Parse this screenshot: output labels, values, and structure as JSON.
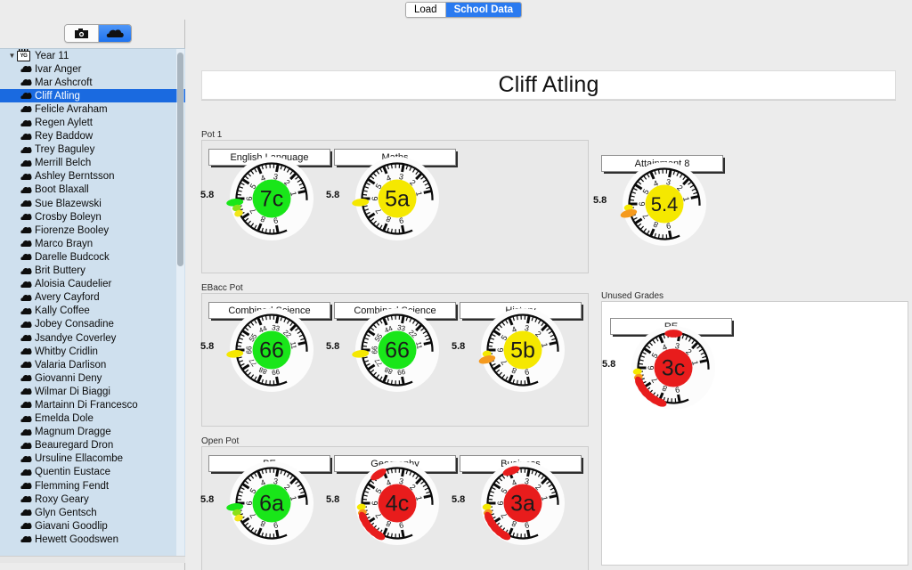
{
  "window": {
    "load_label": "Load",
    "school_data_label": "School Data"
  },
  "sidebar": {
    "view_icons": [
      "dial-view-icon",
      "line-chart-view-icon",
      "table-view-icon"
    ],
    "selected_view": 0,
    "toolbar_icons": [
      "camera-icon",
      "cloud-icon"
    ],
    "selected_toolbar": 1,
    "group": {
      "label": "Year 11",
      "icon": "year-group-icon"
    },
    "selected_student": "Cliff Atling",
    "students": [
      "Ivar Anger",
      "Mar Ashcroft",
      "Cliff Atling",
      "Felicle Avraham",
      "Regen Aylett",
      "Rey Baddow",
      "Trey Baguley",
      "Merrill Belch",
      "Ashley Berntsson",
      "Boot Blaxall",
      "Sue Blazewski",
      "Crosby Boleyn",
      "Fiorenze Booley",
      "Marco Brayn",
      "Darelle Budcock",
      "Brit Buttery",
      "Aloisia Caudelier",
      "Avery Cayford",
      "Kally Coffee",
      "Jobey Consadine",
      "Jsandye Coverley",
      "Whitby Cridlin",
      "Valaria Darlison",
      "Giovanni Deny",
      "Wilmar Di Biaggi",
      "Martainn Di Francesco",
      "Emelda Dole",
      "Magnum Dragge",
      "Beauregard Dron",
      "Ursuline Ellacombe",
      "Quentin Eustace",
      "Flemming Fendt",
      "Roxy Geary",
      "Glyn Gentsch",
      "Giavani Goodlip",
      "Hewett Goodswen"
    ]
  },
  "main": {
    "student_title": "Cliff Atling",
    "sections": {
      "pot1": "Pot 1",
      "ebacc": "EBacc Pot",
      "open": "Open Pot",
      "unused": "Unused Grades"
    }
  },
  "chart_data": {
    "type": "gauge",
    "scale_min": 1,
    "scale_max": 9,
    "target_label": "5.8",
    "gauges": [
      {
        "id": "english-language",
        "section": "pot1",
        "subject": "English Language",
        "grade": "7c",
        "grade_color": "#19e619",
        "value": 7.3,
        "target": 5.8,
        "dial_labels": [
          "1",
          "2",
          "3",
          "4",
          "5",
          "6",
          "7",
          "8",
          "9"
        ],
        "markers": [
          {
            "color": "#19e619",
            "size": "large",
            "offset": 0
          },
          {
            "color": "#8be01a",
            "size": "small",
            "offset": 1
          },
          {
            "color": "#f2e61a",
            "size": "small",
            "offset": 2
          }
        ],
        "trail": []
      },
      {
        "id": "maths",
        "section": "pot1",
        "subject": "Maths",
        "grade": "5a",
        "grade_color": "#f5e800",
        "value": 5.9,
        "target": 5.8,
        "dial_labels": [
          "1",
          "2",
          "3",
          "4",
          "5",
          "6",
          "7",
          "8",
          "9"
        ],
        "markers": [
          {
            "color": "#f5e800",
            "size": "large",
            "offset": 0
          }
        ],
        "trail": []
      },
      {
        "id": "attainment-8",
        "section": "attainment",
        "subject": "Attainment 8",
        "grade": "5.4",
        "grade_color": "#f5e800",
        "value": 5.4,
        "target": 5.8,
        "dial_labels": [
          "1",
          "2",
          "3",
          "4",
          "5",
          "6",
          "7",
          "8",
          "9"
        ],
        "markers": [
          {
            "color": "#f5e800",
            "size": "small",
            "offset": 0
          },
          {
            "color": "#f59a1e",
            "size": "large",
            "offset": 1
          }
        ],
        "trail": []
      },
      {
        "id": "combined-science-1",
        "section": "ebacc",
        "subject": "Combined Science",
        "grade": "66",
        "grade_color": "#19e619",
        "value": 6.0,
        "target": 5.8,
        "dial_labels": [
          "11",
          "22",
          "33",
          "44",
          "55",
          "66",
          "77",
          "88",
          "99"
        ],
        "markers": [
          {
            "color": "#f5e800",
            "size": "large",
            "offset": 0
          }
        ],
        "trail": []
      },
      {
        "id": "combined-science-2",
        "section": "ebacc",
        "subject": "Combined Science",
        "grade": "66",
        "grade_color": "#19e619",
        "value": 6.0,
        "target": 5.8,
        "dial_labels": [
          "11",
          "22",
          "33",
          "44",
          "55",
          "66",
          "77",
          "88",
          "99"
        ],
        "markers": [
          {
            "color": "#f5e800",
            "size": "large",
            "offset": 0
          }
        ],
        "trail": []
      },
      {
        "id": "history",
        "section": "ebacc",
        "subject": "History",
        "grade": "5b",
        "grade_color": "#f5e800",
        "value": 5.5,
        "target": 5.8,
        "dial_labels": [
          "1",
          "2",
          "3",
          "4",
          "5",
          "6",
          "7",
          "8",
          "9"
        ],
        "markers": [
          {
            "color": "#f5e800",
            "size": "small",
            "offset": 0
          },
          {
            "color": "#f59a1e",
            "size": "large",
            "offset": 1
          }
        ],
        "trail": []
      },
      {
        "id": "pe",
        "section": "open",
        "subject": "PE",
        "grade": "6a",
        "grade_color": "#19e619",
        "value": 6.9,
        "target": 5.8,
        "dial_labels": [
          "1",
          "2",
          "3",
          "4",
          "5",
          "6",
          "7",
          "8",
          "9"
        ],
        "markers": [
          {
            "color": "#19e619",
            "size": "large",
            "offset": 0
          },
          {
            "color": "#8be01a",
            "size": "small",
            "offset": 1
          },
          {
            "color": "#f2e61a",
            "size": "small",
            "offset": 2
          }
        ],
        "trail": []
      },
      {
        "id": "geography",
        "section": "open",
        "subject": "Geography",
        "grade": "4c",
        "grade_color": "#e81c1c",
        "value": 4.3,
        "target": 5.8,
        "dial_labels": [
          "1",
          "2",
          "3",
          "4",
          "5",
          "6",
          "7",
          "8",
          "9"
        ],
        "markers": [
          {
            "color": "#f5e800",
            "size": "small",
            "offset": 0
          },
          {
            "color": "#f59a1e",
            "size": "small",
            "offset": 1
          }
        ],
        "trail": [
          {
            "color": "#e81c1c",
            "steps": 5
          }
        ]
      },
      {
        "id": "business",
        "section": "open",
        "subject": "Business",
        "grade": "3a",
        "grade_color": "#e81c1c",
        "value": 3.9,
        "target": 5.8,
        "dial_labels": [
          "1",
          "2",
          "3",
          "4",
          "5",
          "6",
          "7",
          "8",
          "9"
        ],
        "markers": [
          {
            "color": "#f5e800",
            "size": "small",
            "offset": 0
          },
          {
            "color": "#f59a1e",
            "size": "small",
            "offset": 1
          }
        ],
        "trail": [
          {
            "color": "#e81c1c",
            "steps": 5
          }
        ]
      },
      {
        "id": "re",
        "section": "unused",
        "subject": "RE",
        "grade": "3c",
        "grade_color": "#e81c1c",
        "value": 3.3,
        "target": 5.8,
        "dial_labels": [
          "1",
          "2",
          "3",
          "4",
          "5",
          "6",
          "7",
          "8",
          "9"
        ],
        "markers": [
          {
            "color": "#f5e800",
            "size": "small",
            "offset": 0
          },
          {
            "color": "#f59a1e",
            "size": "small",
            "offset": 1
          }
        ],
        "trail": [
          {
            "color": "#e81c1c",
            "steps": 6
          }
        ]
      }
    ]
  }
}
